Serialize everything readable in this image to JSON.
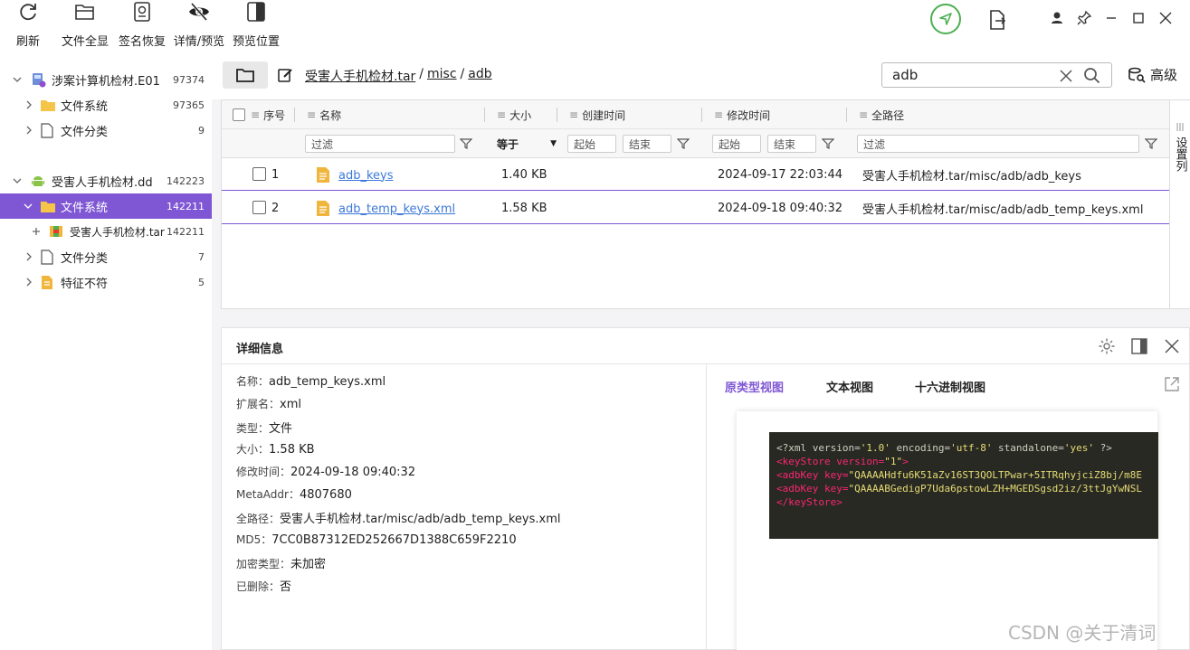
{
  "toolbar": {
    "refresh": "刷新",
    "show_all": "文件全显",
    "sig_restore": "签名恢复",
    "detail_preview": "详情/预览",
    "preview_pos": "预览位置"
  },
  "tree": {
    "case1": {
      "label": "涉案计算机检材.E01",
      "count": "97374"
    },
    "case1_fs": {
      "label": "文件系统",
      "count": "97365"
    },
    "case1_cls": {
      "label": "文件分类",
      "count": "9"
    },
    "case2": {
      "label": "受害人手机检材.dd",
      "count": "142223"
    },
    "case2_fs": {
      "label": "文件系统",
      "count": "142211"
    },
    "case2_tar": {
      "label": "受害人手机检材.tar",
      "count": "142211"
    },
    "case2_cls": {
      "label": "文件分类",
      "count": "7"
    },
    "case2_sig": {
      "label": "特征不符",
      "count": "5"
    }
  },
  "path": {
    "seg1": "受害人手机检材.tar",
    "sep1": "/",
    "seg2": "misc",
    "sep2": "/",
    "seg3": "adb"
  },
  "search": {
    "value": "adb",
    "advanced": "高级"
  },
  "grid": {
    "columns": {
      "index": "序号",
      "name": "名称",
      "size": "大小",
      "created": "创建时间",
      "modified": "修改时间",
      "fullpath": "全路径"
    },
    "filters": {
      "name": "过滤",
      "size_op": "等于",
      "c_start": "起始",
      "c_end": "结束",
      "m_start": "起始",
      "m_end": "结束",
      "path": "过滤"
    },
    "settings_col": "设置列",
    "rows": [
      {
        "index": "1",
        "name": "adb_keys",
        "size": "1.40 KB",
        "created": "",
        "modified": "2024-09-17 22:03:44",
        "fullpath": "受害人手机检材.tar/misc/adb/adb_keys"
      },
      {
        "index": "2",
        "name": "adb_temp_keys.xml",
        "size": "1.58 KB",
        "created": "",
        "modified": "2024-09-18 09:40:32",
        "fullpath": "受害人手机检材.tar/misc/adb/adb_temp_keys.xml"
      }
    ]
  },
  "detail": {
    "title": "详细信息",
    "fields": [
      {
        "k": "名称：",
        "v": "adb_temp_keys.xml"
      },
      {
        "k": "扩展名：",
        "v": "xml"
      },
      {
        "k": "类型：",
        "v": "文件"
      },
      {
        "k": "大小：",
        "v": "1.58 KB"
      },
      {
        "k": "修改时间：",
        "v": "2024-09-18 09:40:32"
      },
      {
        "k": "MetaAddr：",
        "v": "4807680"
      },
      {
        "k": "全路径：",
        "v": "受害人手机检材.tar/misc/adb/adb_temp_keys.xml"
      },
      {
        "k": "MD5：",
        "v": "7CC0B87312ED252667D1388C659F2210"
      },
      {
        "k": "加密类型：",
        "v": "未加密"
      },
      {
        "k": "已删除：",
        "v": "否"
      }
    ],
    "tabs": {
      "raw": "原类型视图",
      "text": "文本视图",
      "hex": "十六进制视图"
    },
    "code": {
      "l1_a": "<?xml version=",
      "l1_b": "'1.0'",
      "l1_c": " encoding=",
      "l1_d": "'utf-8'",
      "l1_e": " standalone=",
      "l1_f": "'yes'",
      "l1_g": " ?>",
      "l2_a": "<keyStore ",
      "l2_b": "version=",
      "l2_c": "\"1\"",
      "l2_d": ">",
      "l3_a": "<adbKey ",
      "l3_b": "key=",
      "l3_c": "\"QAAAAHdfu6K51aZv16ST3QOLTPwar+5ITRqhyjciZ8bj/m8E",
      "l4_a": "<adbKey ",
      "l4_b": "key=",
      "l4_c": "\"QAAAABGedigP7Uda6pstowLZH+MGEDSgsd2iz/3ttJgYwNSL",
      "l5": "</keyStore>"
    }
  },
  "watermark": "CSDN @关于清词",
  "colors": {
    "accent": "#7f57d4",
    "link": "#3b78d9",
    "folder": "#f5c54a",
    "code_bg": "#282923"
  }
}
